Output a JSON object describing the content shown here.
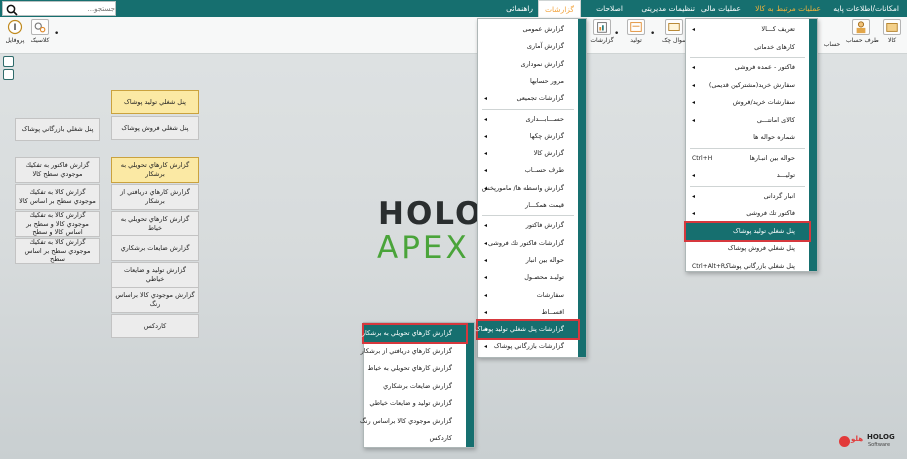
{
  "menubar": {
    "search_placeholder": "جستجو...",
    "items": [
      "امکانات/اطلاعات پایه",
      "عملیات مرتبط به کالا",
      "عملیات مالی",
      "تنظیمات مدیریتی",
      "اصلاحات",
      "گزارشات",
      "راهنمائی"
    ]
  },
  "toolbar": {
    "left_buttons": [
      "پروفایل",
      "کلاسیک"
    ],
    "right_buttons": [
      "کالا",
      "طرف حساب",
      "حساب",
      "سوال چک",
      "تولید",
      "گزارشات"
    ]
  },
  "background": {
    "logo_line1": "HOLOG",
    "logo_line2": "APEX"
  },
  "left_panel": {
    "col1": [
      "پنل شغلي بازرگاني پوشاک",
      "گزارش فاكتور به تفكيك موجودي سطح كالا",
      "گزارش كالا به تفكيك موجودي سطح بر اساس كالا",
      "گزارش كالا به تفكيك موجودي كالا و سطح بر اساس كالا و سطح",
      "گزارش كالا به تفكيك موجودي سطح بر اساس سطح"
    ],
    "col2": [
      "پنل شغلي توليد پوشاک",
      "پنل شغلي فروش پوشاک",
      "گزارش كارهاي تحويلي به برشكار",
      "گزارش كارهاي دريافتي از برشكار",
      "گزارش كارهاي تحويلي به خياط",
      "گزارش ضايعات برشكاري",
      "گزارش توليد و ضايعات خياطي",
      "گزارش موجودي كالا براساس رنگ",
      "كاردكس"
    ]
  },
  "menu_operations": {
    "items": [
      {
        "label": "تعریف کـــالا",
        "arrow": true,
        "shortcut": ""
      },
      {
        "label": "كارهای خدماتی",
        "arrow": false,
        "shortcut": ""
      },
      {
        "label": "فاكتور - عمده فروشی",
        "arrow": true,
        "shortcut": ""
      },
      {
        "label": "سفارش خرید(مشتركین قدیمی)",
        "arrow": true,
        "shortcut": ""
      },
      {
        "label": "سفارشات خرید/فروش",
        "arrow": true,
        "shortcut": ""
      },
      {
        "label": "كالای امانتـــی",
        "arrow": true,
        "shortcut": ""
      },
      {
        "label": "شماره حواله ها",
        "arrow": false,
        "shortcut": ""
      },
      {
        "label": "حواله بین انبـارها",
        "arrow": false,
        "shortcut": "Ctrl+H"
      },
      {
        "label": "تولیـــد",
        "arrow": true,
        "shortcut": ""
      },
      {
        "label": "انبار گردانی",
        "arrow": true,
        "shortcut": ""
      },
      {
        "label": "فاکتور تك فروشی",
        "arrow": true,
        "shortcut": ""
      },
      {
        "label": "پنل شغلي توليد پوشاک",
        "arrow": false,
        "shortcut": ""
      },
      {
        "label": "پنل شغلي فروش پوشاک",
        "arrow": false,
        "shortcut": ""
      },
      {
        "label": "پنل شغلي بازرگاني پوشاک",
        "arrow": false,
        "shortcut": "Ctrl+Alt+P"
      }
    ]
  },
  "menu_reports": {
    "items": [
      {
        "label": "گزارش عمومی",
        "arrow": false
      },
      {
        "label": "گزارش آماری",
        "arrow": false
      },
      {
        "label": "گزارش نموداری",
        "arrow": false
      },
      {
        "label": "مرور حسابها",
        "arrow": false
      },
      {
        "label": "گزارشات تجمیعی",
        "arrow": true
      },
      {
        "label": "حســـابـــداری",
        "arrow": true
      },
      {
        "label": "گزارش چكها",
        "arrow": true
      },
      {
        "label": "گزارش كالا",
        "arrow": true
      },
      {
        "label": "طرف حســاب",
        "arrow": true
      },
      {
        "label": "گزارش واسطه ها/ مامورپخش",
        "arrow": true
      },
      {
        "label": "قیمت همكـــار",
        "arrow": false
      },
      {
        "label": "گزارش فاكتور",
        "arrow": true
      },
      {
        "label": "گزارشات فاكتور تك فروشی",
        "arrow": true
      },
      {
        "label": "حواله بین انبار",
        "arrow": true
      },
      {
        "label": "تولیـد محصـول",
        "arrow": true
      },
      {
        "label": "سفارشات",
        "arrow": true
      },
      {
        "label": "اقســاط",
        "arrow": true
      },
      {
        "label": "گزارشات پنل شغلي توليد پوشاک",
        "arrow": true
      },
      {
        "label": "گزارشات بازرگاني پوشاک",
        "arrow": true
      }
    ]
  },
  "submenu": {
    "items": [
      "گزارش كارهاي تحويلي به برشكار",
      "گزارش كارهاي دريافتي از برشكار",
      "گزارش كارهاي تحويلي به خياط",
      "گزارش ضايعات برشكاري",
      "گزارش توليد و ضايعات خياطي",
      "گزارش موجودي كالا براساس رنگ",
      "كاردكس"
    ]
  },
  "company": {
    "mark_text": "هلو",
    "name": "HOLOG",
    "sub": "Software"
  }
}
